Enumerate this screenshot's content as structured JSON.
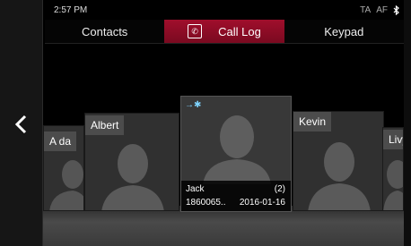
{
  "status": {
    "time": "2:57 PM",
    "ta": "TA",
    "af": "AF",
    "bluetooth_icon": "bluetooth-icon"
  },
  "tabs": [
    {
      "label": "Contacts"
    },
    {
      "label": "Call Log",
      "icon": "phone-call-log-icon"
    },
    {
      "label": "Keypad"
    }
  ],
  "nav": {
    "back_icon": "chevron-left-icon"
  },
  "contacts": [
    {
      "name": "A da"
    },
    {
      "name": "Albert"
    },
    {
      "name": "Jack",
      "count": "(2)",
      "number": "1860065..",
      "date": "2016-01-16",
      "bluetooth": "bluetooth-phone-icon"
    },
    {
      "name": "Kevin"
    },
    {
      "name": "Livy"
    }
  ],
  "colors": {
    "active_tab": "#a00e2c",
    "background": "#000000"
  }
}
